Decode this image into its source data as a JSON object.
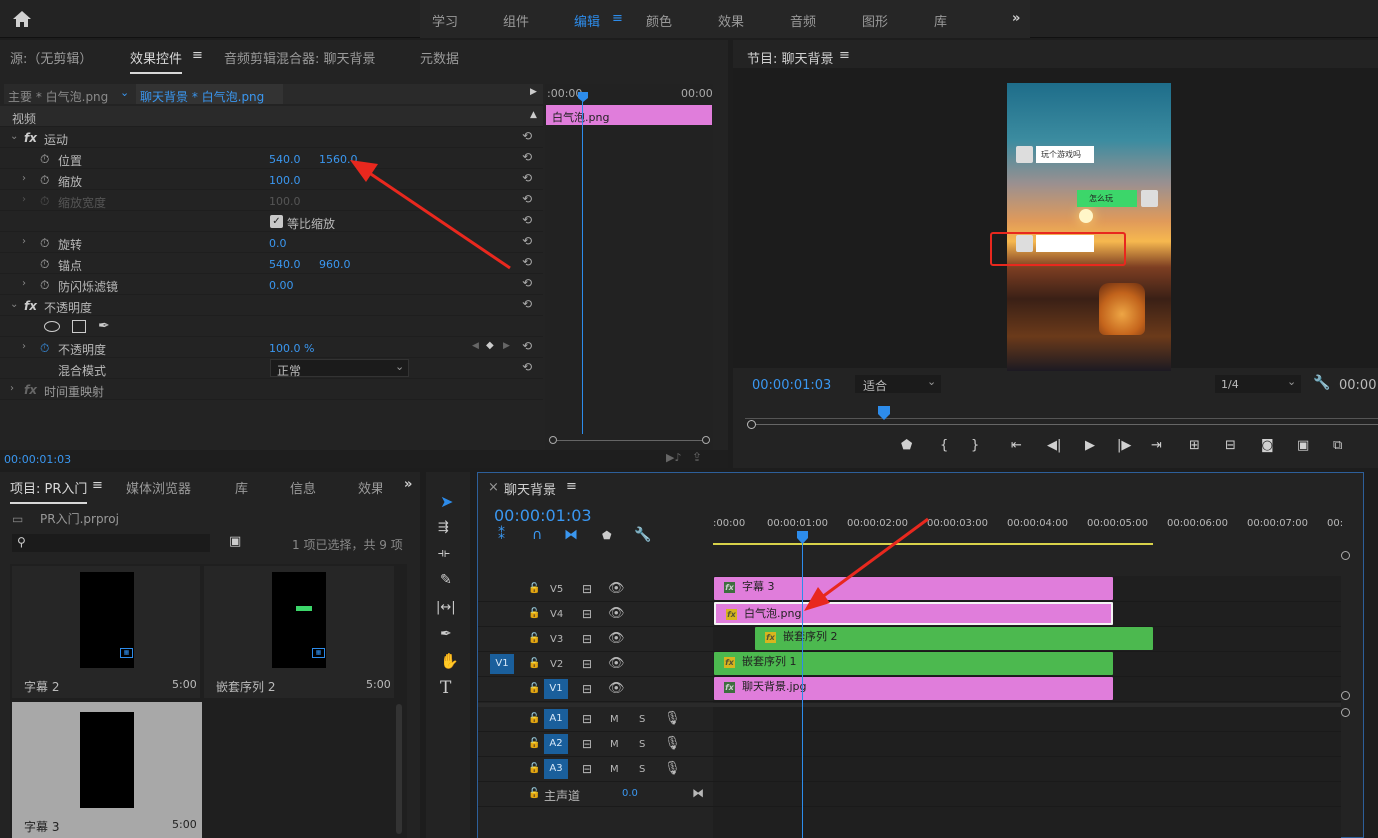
{
  "header": {
    "workspaces": [
      "学习",
      "组件",
      "编辑",
      "颜色",
      "效果",
      "音频",
      "图形",
      "库"
    ],
    "active_workspace": "编辑",
    "more": "»"
  },
  "effect_controls": {
    "tabs": [
      "源:（无剪辑）",
      "效果控件",
      "音频剪辑混合器: 聊天背景",
      "元数据"
    ],
    "master": "主要 * 白气泡.png",
    "sequence_clip": "聊天背景 * 白气泡.png",
    "mini_timeline": {
      "start": ":00:00",
      "end": "00:00",
      "clip": "白气泡.png"
    },
    "video_label": "视频",
    "motion": "运动",
    "position": {
      "label": "位置",
      "x": "540.0",
      "y": "1560.0"
    },
    "scale": {
      "label": "缩放",
      "value": "100.0"
    },
    "scale_width": {
      "label": "缩放宽度",
      "value": "100.0"
    },
    "uniform_scale": "等比缩放",
    "rotation": {
      "label": "旋转",
      "value": "0.0"
    },
    "anchor": {
      "label": "锚点",
      "x": "540.0",
      "y": "960.0"
    },
    "antiflicker": {
      "label": "防闪烁滤镜",
      "value": "0.00"
    },
    "opacity_group": "不透明度",
    "opacity": {
      "label": "不透明度",
      "value": "100.0 %"
    },
    "blend_mode": {
      "label": "混合模式",
      "value": "正常"
    },
    "time_remap": "时间重映射",
    "timecode": "00:00:01:03"
  },
  "program": {
    "title": "节目: 聊天背景",
    "timecode": "00:00:01:03",
    "fit": "适合",
    "resolution": "1/4",
    "end_timecode": "00:00:",
    "bubbles": [
      "玩个游戏吗",
      "怎么玩"
    ]
  },
  "project": {
    "tabs": [
      "项目: PR入门",
      "媒体浏览器",
      "库",
      "信息",
      "效果"
    ],
    "file": "PR入门.prproj",
    "status": "1 项已选择，共 9 项",
    "items": [
      {
        "name": "字幕 2",
        "duration": "5:00"
      },
      {
        "name": "嵌套序列 2",
        "duration": "5:00"
      },
      {
        "name": "字幕 3",
        "duration": "5:00"
      }
    ]
  },
  "timeline": {
    "title": "聊天背景",
    "timecode": "00:00:01:03",
    "ruler": [
      ":00:00",
      "00:00:01:00",
      "00:00:02:00",
      "00:00:03:00",
      "00:00:04:00",
      "00:00:05:00",
      "00:00:06:00",
      "00:00:07:00",
      "00:"
    ],
    "video_tracks": [
      "V5",
      "V4",
      "V3",
      "V2",
      "V1"
    ],
    "source_patch": "V1",
    "audio_tracks": [
      "A1",
      "A2",
      "A3"
    ],
    "audio_buttons": {
      "m": "M",
      "s": "S"
    },
    "master": {
      "label": "主声道",
      "value": "0.0"
    },
    "clips": {
      "v5": "字幕 3",
      "v4": "白气泡.png",
      "v3": "嵌套序列 2",
      "v2": "嵌套序列 1",
      "v1": "聊天背景.jpg"
    }
  },
  "colors": {
    "accent": "#2d8ceb",
    "clip_pink": "#e07ddb",
    "clip_green": "#4cb94f",
    "annotation": "#e8281e"
  }
}
